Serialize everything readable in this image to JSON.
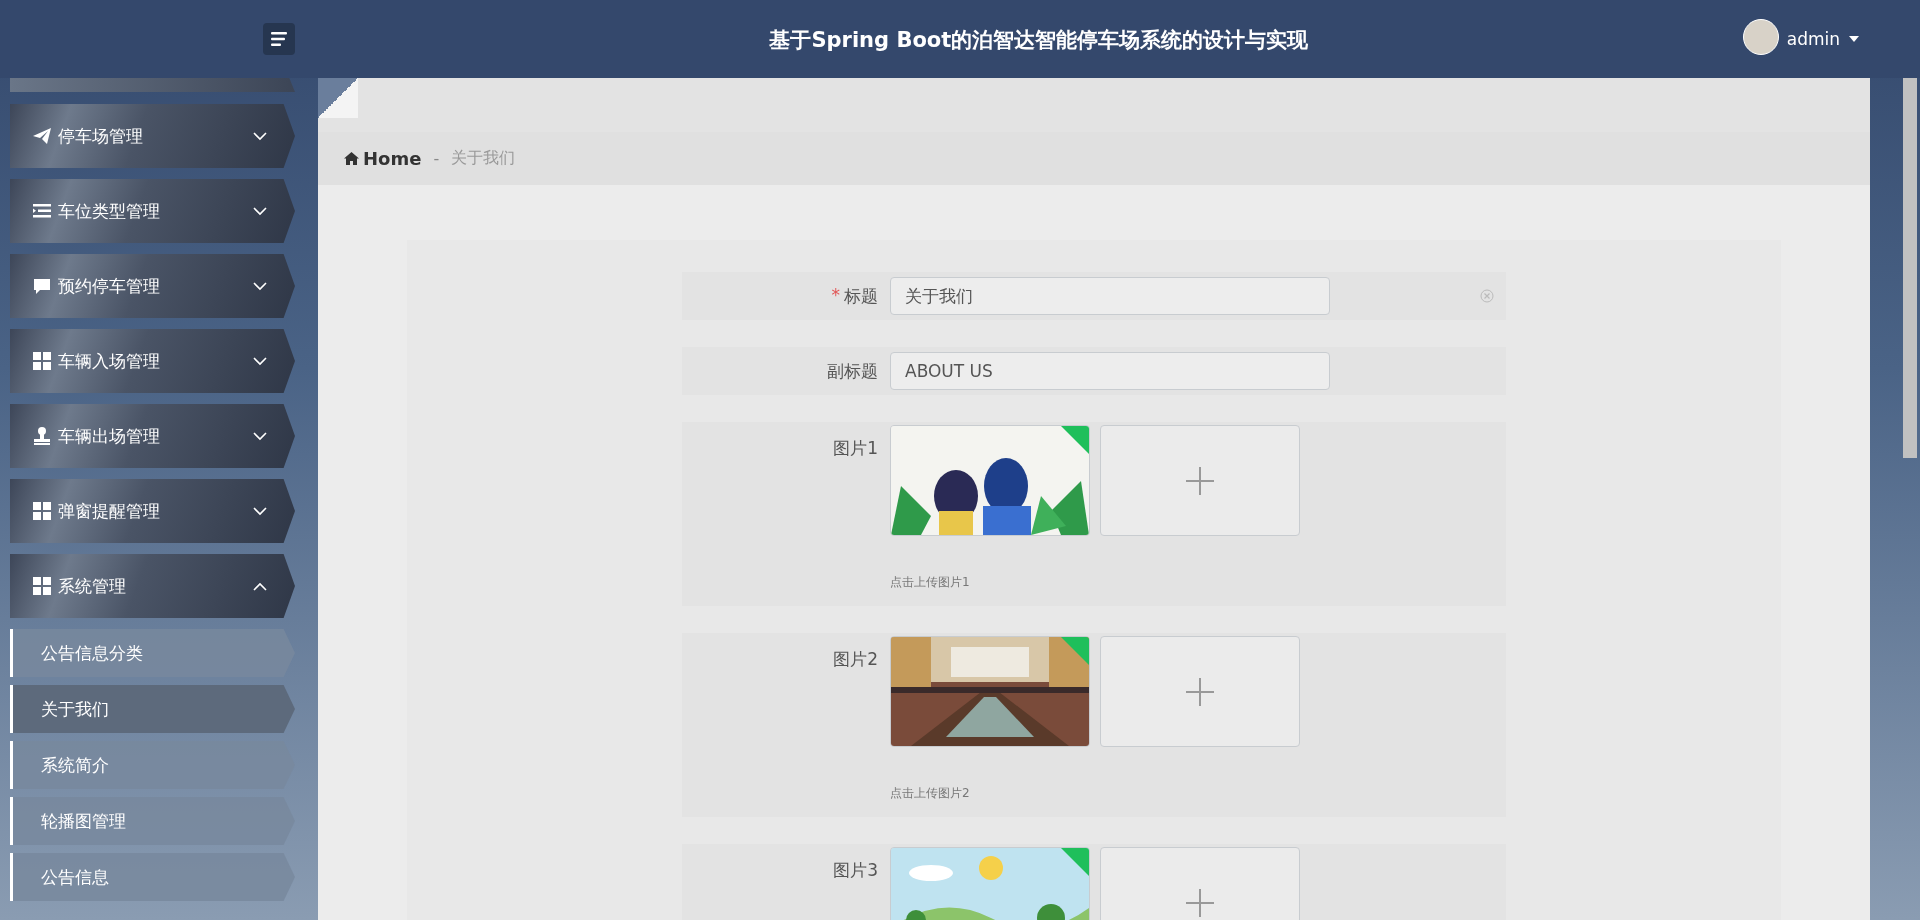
{
  "header": {
    "title": "基于Spring Boot的泊智达智能停车场系统的设计与实现",
    "user": "admin"
  },
  "sidebar": {
    "groups": [
      {
        "label": "停车场管理",
        "expanded": false
      },
      {
        "label": "车位类型管理",
        "expanded": false
      },
      {
        "label": "预约停车管理",
        "expanded": false
      },
      {
        "label": "车辆入场管理",
        "expanded": false
      },
      {
        "label": "车辆出场管理",
        "expanded": false
      },
      {
        "label": "弹窗提醒管理",
        "expanded": false
      },
      {
        "label": "系统管理",
        "expanded": true,
        "children": [
          {
            "label": "公告信息分类",
            "selected": false
          },
          {
            "label": "关于我们",
            "selected": true
          },
          {
            "label": "系统简介",
            "selected": false
          },
          {
            "label": "轮播图管理",
            "selected": false
          },
          {
            "label": "公告信息",
            "selected": false
          }
        ]
      }
    ]
  },
  "breadcrumb": {
    "home": "Home",
    "separator": "-",
    "current": "关于我们"
  },
  "form": {
    "fields": [
      {
        "kind": "text",
        "label": "标题",
        "required_mark": "*",
        "value": "关于我们",
        "clearable": true
      },
      {
        "kind": "text",
        "label": "副标题",
        "value": "ABOUT US",
        "clearable": false
      },
      {
        "label": "图片1",
        "hint": "点击上传图片1"
      },
      {
        "label": "图片2",
        "hint": "点击上传图片2"
      },
      {
        "label": "图片3"
      }
    ]
  }
}
